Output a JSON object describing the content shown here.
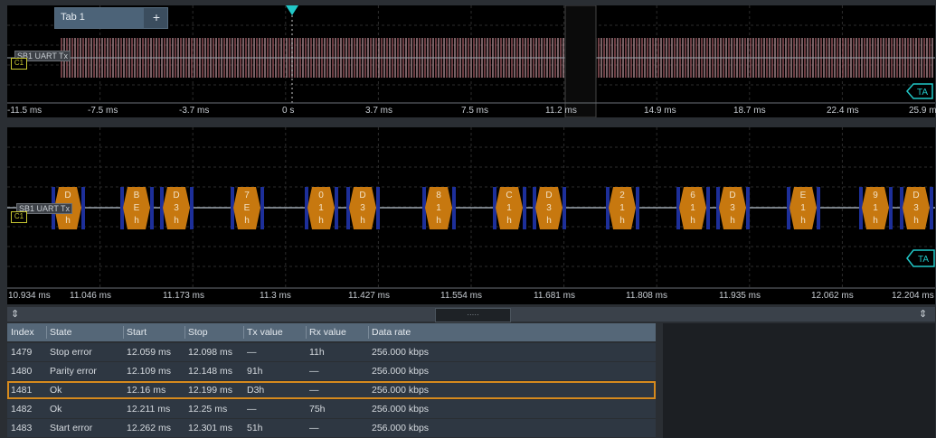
{
  "tabs": {
    "tab1": "Tab 1",
    "add": "+"
  },
  "overview": {
    "label": "SB1 UART Tx",
    "trigger_tag": "C1",
    "ta_tag": "TA",
    "ticks": [
      "-11.5 ms",
      "-7.5 ms",
      "-3.7 ms",
      "0 s",
      "3.7 ms",
      "7.5 ms",
      "11.2 ms",
      "14.9 ms",
      "18.7 ms",
      "22.4 ms",
      "25.9 ms"
    ]
  },
  "zoom": {
    "label": "SB1 UART Tx",
    "trigger_tag": "C1",
    "ta_tag": "TA",
    "ticks": [
      "10.934 ms",
      "11.046 ms",
      "11.173 ms",
      "11.3 ms",
      "11.427 ms",
      "11.554 ms",
      "11.681 ms",
      "11.808 ms",
      "11.935 ms",
      "12.062 ms",
      "12.204 ms"
    ],
    "frames": [
      {
        "text": "D\nX\nh"
      },
      {
        "text": "B\nE\nh"
      },
      {
        "text": "D\n3\nh"
      },
      {
        "text": "7\nE\nh"
      },
      {
        "text": "0\n1\nh"
      },
      {
        "text": "D\n3\nh"
      },
      {
        "text": "8\n1\nh"
      },
      {
        "text": "C\n1\nh"
      },
      {
        "text": "D\n3\nh"
      },
      {
        "text": "2\n1\nh"
      },
      {
        "text": "6\n1\nh"
      },
      {
        "text": "D\n3\nh"
      },
      {
        "text": "E\n1\nh"
      },
      {
        "text": "9\n1\nh"
      },
      {
        "text": "D\n3\nh"
      }
    ]
  },
  "table": {
    "handle": "·····",
    "up_down": "⇕",
    "columns": [
      "Index",
      "State",
      "Start",
      "Stop",
      "Tx value",
      "Rx value",
      "Data rate"
    ],
    "rows": [
      [
        "1479",
        "Stop error",
        "12.059 ms",
        "12.098 ms",
        "—",
        "11h",
        "256.000 kbps"
      ],
      [
        "1480",
        "Parity error",
        "12.109 ms",
        "12.148 ms",
        "91h",
        "—",
        "256.000 kbps"
      ],
      [
        "1481",
        "Ok",
        "12.16 ms",
        "12.199 ms",
        "D3h",
        "—",
        "256.000 kbps"
      ],
      [
        "1482",
        "Ok",
        "12.211 ms",
        "12.25 ms",
        "—",
        "75h",
        "256.000 kbps"
      ],
      [
        "1483",
        "Start error",
        "12.262 ms",
        "12.301 ms",
        "51h",
        "—",
        "256.000 kbps"
      ]
    ],
    "selected_row": 2
  },
  "colors": {
    "frame": "#c7780f",
    "frame_edge": "#1d2f9a",
    "ta": "#21c7c7",
    "selection": "#d68a1d"
  }
}
